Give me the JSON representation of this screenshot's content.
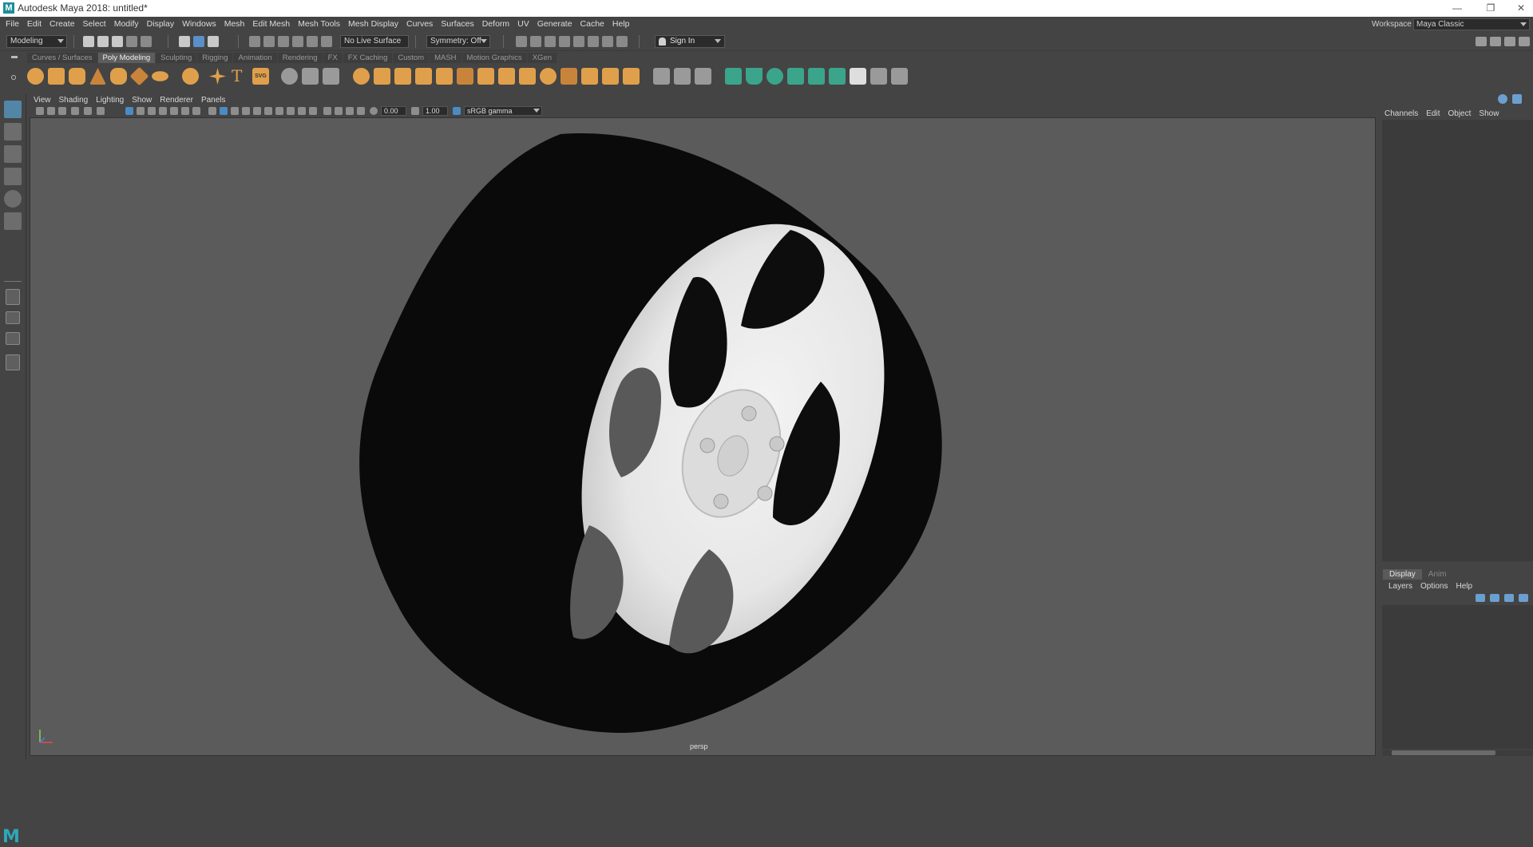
{
  "window": {
    "title": "Autodesk Maya 2018: untitled*",
    "logo": "M"
  },
  "menubar": {
    "items": [
      "File",
      "Edit",
      "Create",
      "Select",
      "Modify",
      "Display",
      "Windows",
      "Mesh",
      "Edit Mesh",
      "Mesh Tools",
      "Mesh Display",
      "Curves",
      "Surfaces",
      "Deform",
      "UV",
      "Generate",
      "Cache",
      "Help"
    ],
    "workspace_label": "Workspace :",
    "workspace_value": "Maya Classic"
  },
  "statusline": {
    "menuset": "Modeling",
    "live_surface": "No Live Surface",
    "symmetry": "Symmetry: Off",
    "sign_in": "Sign In"
  },
  "shelf": {
    "tabs": [
      "Curves / Surfaces",
      "Poly Modeling",
      "Sculpting",
      "Rigging",
      "Animation",
      "Rendering",
      "FX",
      "FX Caching",
      "Custom",
      "MASH",
      "Motion Graphics",
      "XGen"
    ],
    "active_tab": "Poly Modeling",
    "text_icon": "T",
    "svg_icon": "SVG"
  },
  "viewport": {
    "panel_menu": [
      "View",
      "Shading",
      "Lighting",
      "Show",
      "Renderer",
      "Panels"
    ],
    "exposure": "0.00",
    "gamma": "1.00",
    "color_space": "sRGB gamma",
    "camera": "persp"
  },
  "channel_box": {
    "menu": [
      "Channels",
      "Edit",
      "Object",
      "Show"
    ]
  },
  "layer_editor": {
    "tabs": [
      "Display",
      "Anim"
    ],
    "active_tab": "Display",
    "menu": [
      "Layers",
      "Options",
      "Help"
    ]
  },
  "colors": {
    "accent": "#5285a6",
    "shelf_icon": "#e0a04b",
    "viewport_bg": "#5b5b5b",
    "tire": "#0a0a0a",
    "rim": "#eeeeee"
  }
}
